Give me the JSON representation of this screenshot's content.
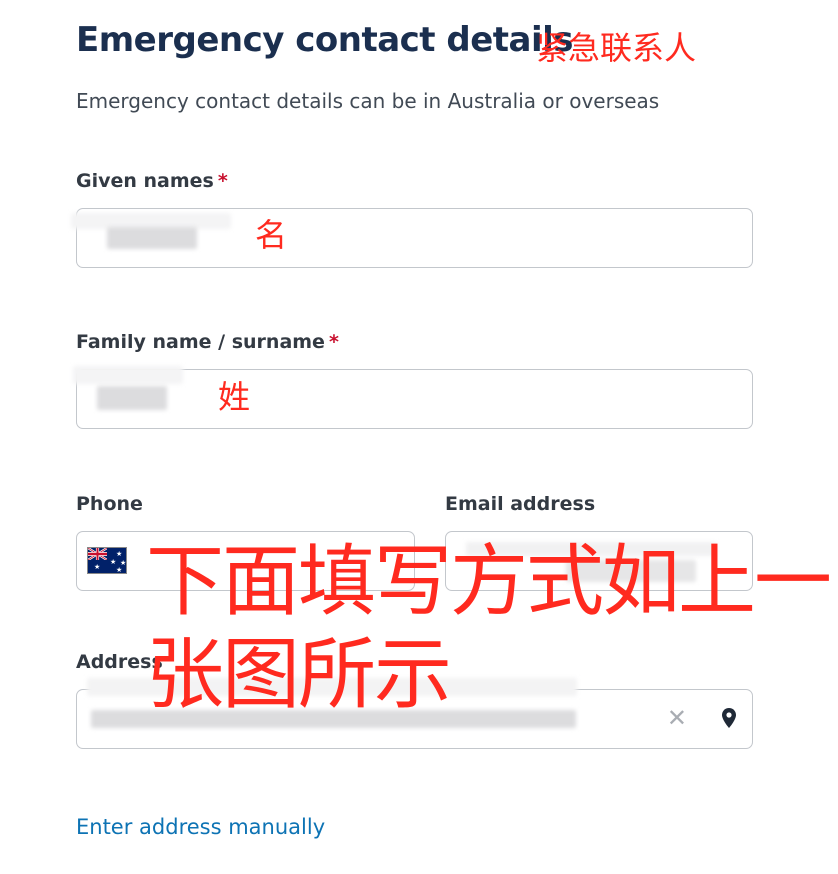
{
  "form": {
    "title": "Emergency contact details",
    "subtitle": "Emergency contact details can be in Australia or overseas",
    "required_marker": "*",
    "given_names": {
      "label": "Given names",
      "value": ""
    },
    "family_name": {
      "label": "Family name / surname",
      "value": ""
    },
    "phone": {
      "label": "Phone",
      "country": "Australia",
      "flag_icon": "australia-flag-icon",
      "value": ""
    },
    "email": {
      "label": "Email address",
      "value": ""
    },
    "address": {
      "label": "Address",
      "value": "",
      "clear_icon": "close-icon",
      "location_icon": "map-pin-icon"
    },
    "manual_link": "Enter address manually"
  },
  "annotations": {
    "title_note": "紧急联系人",
    "given_note": "名",
    "family_note": "姓",
    "instruction_line1": "下面填写方式如上一",
    "instruction_line2": "张图所示"
  },
  "colors": {
    "title": "#1b2f4f",
    "required": "#c8102e",
    "link": "#0d73b4",
    "annotation": "#ff2a1f",
    "field_border": "#c3c7cc"
  }
}
